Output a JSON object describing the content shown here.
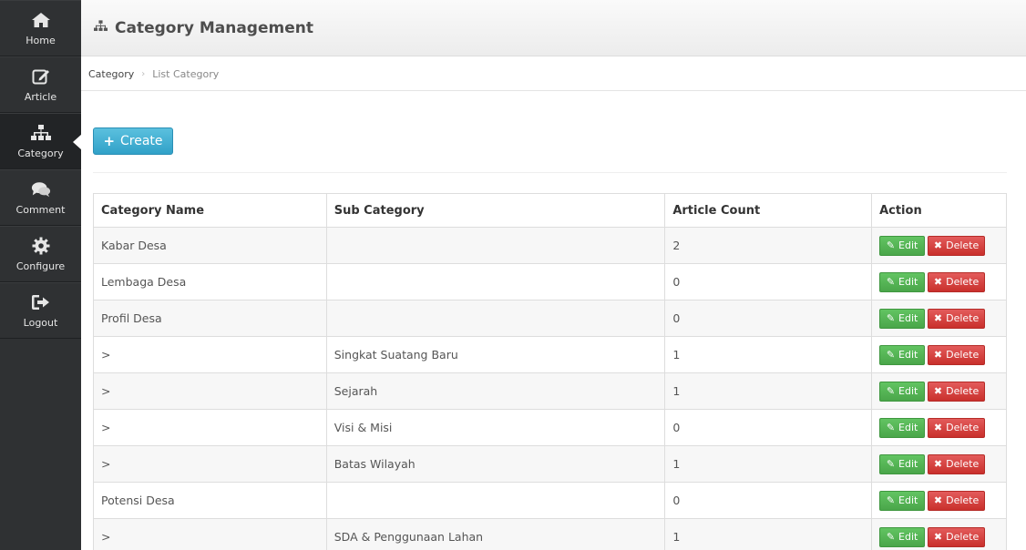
{
  "sidebar": {
    "items": [
      {
        "label": "Home",
        "icon": "home-icon"
      },
      {
        "label": "Article",
        "icon": "edit-icon"
      },
      {
        "label": "Category",
        "icon": "sitemap-icon",
        "active": true
      },
      {
        "label": "Comment",
        "icon": "comments-icon"
      },
      {
        "label": "Configure",
        "icon": "gear-icon"
      },
      {
        "label": "Logout",
        "icon": "sign-out-icon"
      }
    ]
  },
  "header": {
    "title": "Category Management",
    "icon": "sitemap-icon"
  },
  "breadcrumb": {
    "items": [
      "Category",
      "List Category"
    ]
  },
  "toolbar": {
    "create_label": "Create"
  },
  "table": {
    "headers": [
      "Category Name",
      "Sub Category",
      "Article Count",
      "Action"
    ],
    "rows": [
      {
        "name": "Kabar Desa",
        "sub": "",
        "count": "2"
      },
      {
        "name": "Lembaga Desa",
        "sub": "",
        "count": "0"
      },
      {
        "name": "Profil Desa",
        "sub": "",
        "count": "0"
      },
      {
        "name": ">",
        "sub": "Singkat Suatang Baru",
        "count": "1"
      },
      {
        "name": ">",
        "sub": "Sejarah",
        "count": "1"
      },
      {
        "name": ">",
        "sub": "Visi & Misi",
        "count": "0"
      },
      {
        "name": ">",
        "sub": "Batas Wilayah",
        "count": "1"
      },
      {
        "name": "Potensi Desa",
        "sub": "",
        "count": "0"
      },
      {
        "name": ">",
        "sub": "SDA & Penggunaan Lahan",
        "count": "1"
      }
    ],
    "edit_label": "Edit",
    "delete_label": "Delete"
  },
  "colors": {
    "sidebar_bg": "#2f3133",
    "create_btn": "#3faed2",
    "edit_btn": "#5cb85c",
    "delete_btn": "#d9534f"
  }
}
